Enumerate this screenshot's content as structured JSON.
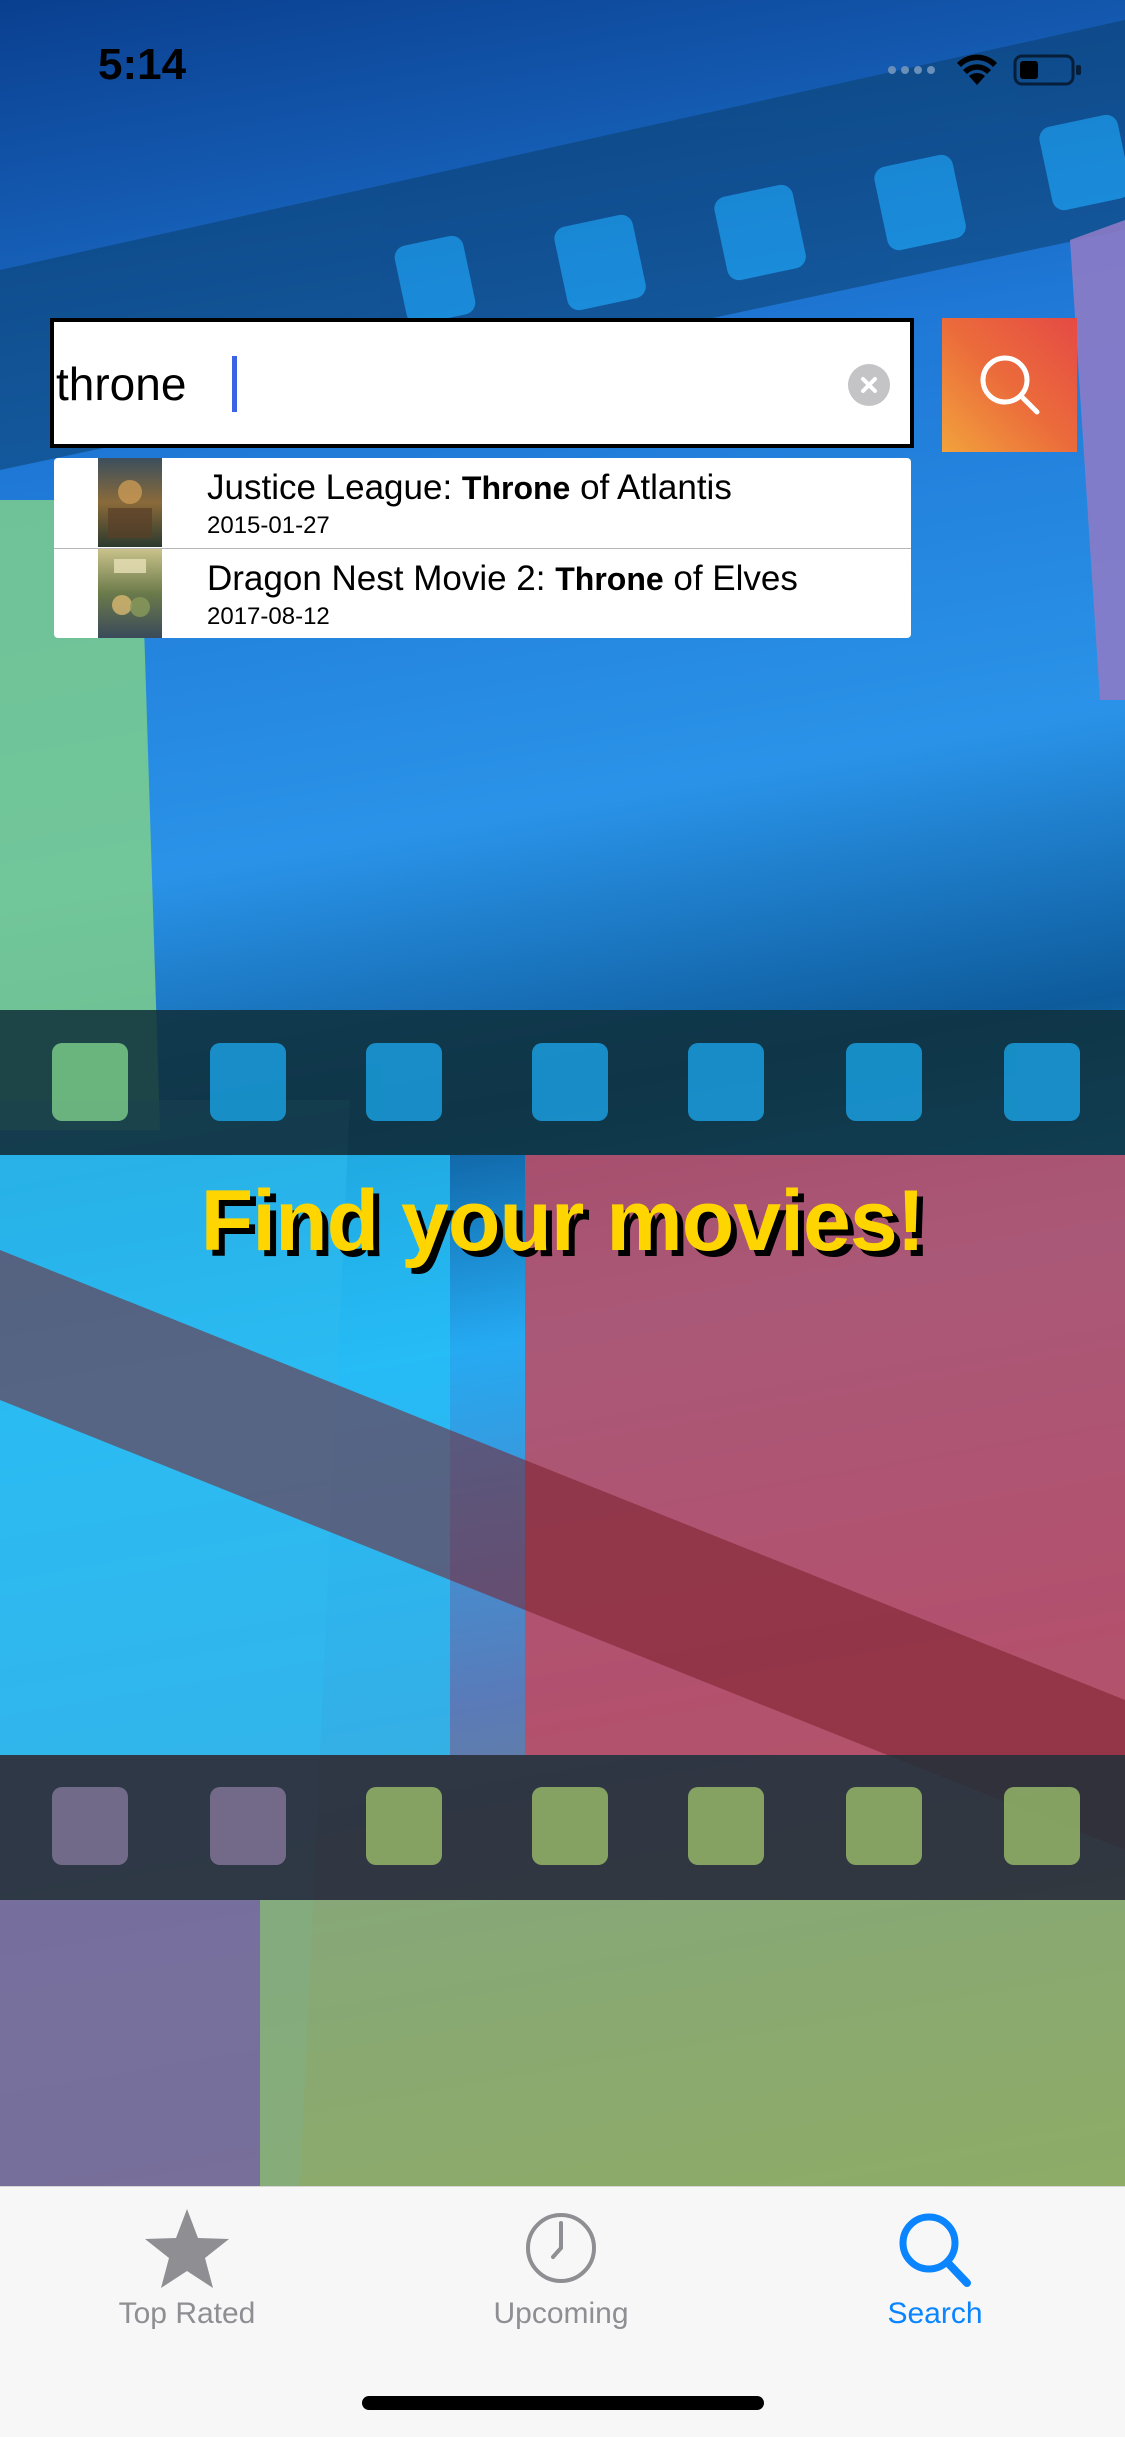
{
  "status_bar": {
    "time": "5:14",
    "icons": [
      "signal-dots-icon",
      "wifi-icon",
      "battery-icon"
    ]
  },
  "search": {
    "value": "throne",
    "clear_icon": "clear-circle-icon",
    "button_icon": "magnifier-icon"
  },
  "results": [
    {
      "title_before": "Justice League: ",
      "title_match": "Throne",
      "title_after": " of Atlantis",
      "date": "2015-01-27"
    },
    {
      "title_before": "Dragon Nest Movie 2: ",
      "title_match": "Throne",
      "title_after": " of Elves",
      "date": "2017-08-12"
    }
  ],
  "headline": "Find your movies!",
  "tabs": [
    {
      "label": "Top Rated",
      "icon": "star-icon",
      "active": false
    },
    {
      "label": "Upcoming",
      "icon": "clock-icon",
      "active": false
    },
    {
      "label": "Search",
      "icon": "search-icon",
      "active": true
    }
  ],
  "colors": {
    "headline": "#ffd500",
    "active_tab": "#0a84ff",
    "inactive_tab": "#8e8e93",
    "search_button_start": "#f2a23c",
    "search_button_end": "#e54a45"
  }
}
